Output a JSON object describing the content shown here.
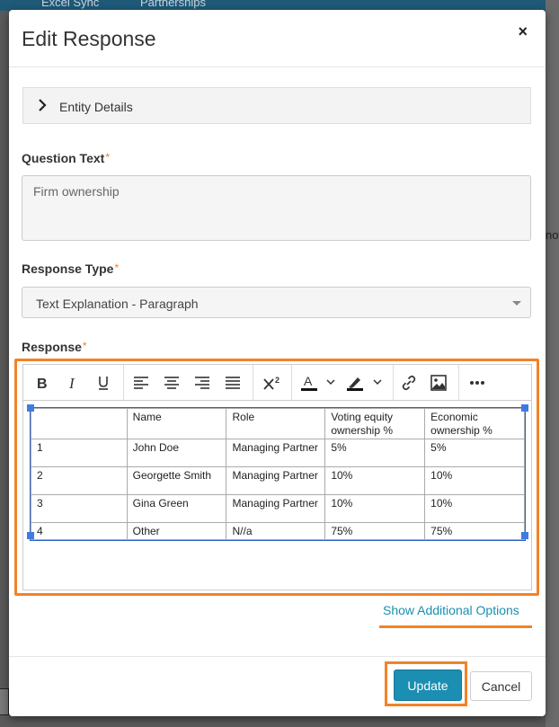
{
  "background": {
    "nav_items": [
      "Excel Sync",
      "Partnerships"
    ],
    "right_fragment": "now"
  },
  "modal": {
    "title": "Edit Response",
    "close_label": "×"
  },
  "accordion": {
    "label": "Entity Details"
  },
  "question": {
    "label": "Question Text",
    "required_mark": "*",
    "value": "Firm ownership"
  },
  "response_type": {
    "label": "Response Type",
    "required_mark": "*",
    "selected": "Text Explanation - Paragraph"
  },
  "response": {
    "label": "Response",
    "required_mark": "*",
    "toolbar": [
      {
        "name": "bold-button",
        "icon": "bold-icon"
      },
      {
        "name": "italic-button",
        "icon": "italic-icon"
      },
      {
        "name": "underline-button",
        "icon": "underline-icon"
      },
      {
        "name": "align-left-button",
        "icon": "align-left-icon"
      },
      {
        "name": "align-center-button",
        "icon": "align-center-icon"
      },
      {
        "name": "align-right-button",
        "icon": "align-right-icon"
      },
      {
        "name": "align-justify-button",
        "icon": "align-justify-icon"
      },
      {
        "name": "superscript-button",
        "icon": "superscript-icon"
      },
      {
        "name": "text-color-button",
        "icon": "text-color-icon"
      },
      {
        "name": "highlight-button",
        "icon": "highlighter-icon"
      },
      {
        "name": "link-button",
        "icon": "link-icon"
      },
      {
        "name": "image-button",
        "icon": "image-icon"
      },
      {
        "name": "more-button",
        "icon": "more-icon"
      }
    ],
    "table": [
      [
        "",
        "Name",
        "Role",
        "Voting equity ownership %",
        "Economic ownership %"
      ],
      [
        "1",
        "John Doe",
        "Managing Partner",
        "5%",
        "5%"
      ],
      [
        "2",
        "Georgette Smith",
        "Managing Partner",
        "10%",
        "10%"
      ],
      [
        "3",
        "Gina Green",
        "Managing Partner",
        "10%",
        "10%"
      ],
      [
        "4",
        "Other",
        "N//a",
        "75%",
        "75%"
      ]
    ]
  },
  "links": {
    "show_additional": "Show Additional Options"
  },
  "footer": {
    "update_label": "Update",
    "cancel_label": "Cancel"
  },
  "colors": {
    "accent": "#1b8eb2",
    "highlight": "#f28227",
    "required": "#f07a1c"
  }
}
